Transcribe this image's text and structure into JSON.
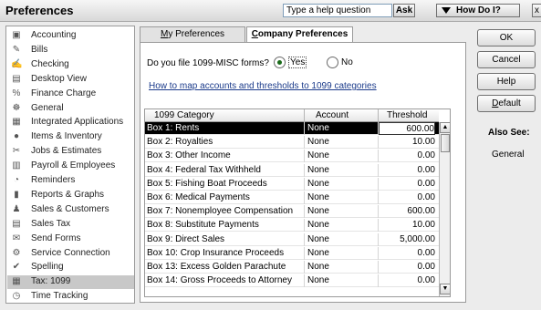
{
  "window": {
    "title": "Preferences",
    "help_placeholder": "Type a help question",
    "ask_label": "Ask",
    "how_do_i_label": "How Do I?",
    "close_label": "x"
  },
  "sidebar": {
    "items": [
      {
        "label": "Accounting",
        "icon": "accounting-icon",
        "glyph": "▣"
      },
      {
        "label": "Bills",
        "icon": "bills-icon",
        "glyph": "✎"
      },
      {
        "label": "Checking",
        "icon": "checking-icon",
        "glyph": "✍"
      },
      {
        "label": "Desktop View",
        "icon": "desktop-view-icon",
        "glyph": "▤"
      },
      {
        "label": "Finance Charge",
        "icon": "finance-charge-icon",
        "glyph": "%"
      },
      {
        "label": "General",
        "icon": "general-icon",
        "glyph": "☸"
      },
      {
        "label": "Integrated Applications",
        "icon": "integrated-apps-icon",
        "glyph": "▦"
      },
      {
        "label": "Items & Inventory",
        "icon": "items-inventory-icon",
        "glyph": "●"
      },
      {
        "label": "Jobs & Estimates",
        "icon": "jobs-estimates-icon",
        "glyph": "✂"
      },
      {
        "label": "Payroll & Employees",
        "icon": "payroll-icon",
        "glyph": "▥"
      },
      {
        "label": "Reminders",
        "icon": "reminders-icon",
        "glyph": "◔"
      },
      {
        "label": "Reports & Graphs",
        "icon": "reports-graphs-icon",
        "glyph": "▮"
      },
      {
        "label": "Sales & Customers",
        "icon": "sales-customers-icon",
        "glyph": "♟"
      },
      {
        "label": "Sales Tax",
        "icon": "sales-tax-icon",
        "glyph": "▤"
      },
      {
        "label": "Send Forms",
        "icon": "send-forms-icon",
        "glyph": "✉"
      },
      {
        "label": "Service Connection",
        "icon": "service-connection-icon",
        "glyph": "⚙"
      },
      {
        "label": "Spelling",
        "icon": "spelling-icon",
        "glyph": "✔"
      },
      {
        "label": "Tax: 1099",
        "icon": "tax-1099-icon",
        "glyph": "▦"
      },
      {
        "label": "Time Tracking",
        "icon": "time-tracking-icon",
        "glyph": "◷"
      }
    ],
    "selected_index": 17
  },
  "tabs": {
    "my_prefix": "",
    "my_hotkey": "M",
    "my_rest": "y Preferences",
    "company_hotkey": "C",
    "company_rest": "ompany Preferences"
  },
  "form": {
    "question": "Do you file 1099-MISC forms?",
    "yes_label": "Yes",
    "no_label": "No",
    "selected": "yes",
    "map_link": "How to map accounts and thresholds to 1099 categories"
  },
  "table": {
    "headers": [
      "1099 Category",
      "Account",
      "Threshold"
    ],
    "rows": [
      {
        "category": "Box 1: Rents",
        "account": "None",
        "threshold": "600.00"
      },
      {
        "category": "Box 2: Royalties",
        "account": "None",
        "threshold": "10.00"
      },
      {
        "category": "Box 3: Other Income",
        "account": "None",
        "threshold": "0.00"
      },
      {
        "category": "Box 4: Federal Tax Withheld",
        "account": "None",
        "threshold": "0.00"
      },
      {
        "category": "Box 5: Fishing Boat Proceeds",
        "account": "None",
        "threshold": "0.00"
      },
      {
        "category": "Box 6: Medical Payments",
        "account": "None",
        "threshold": "0.00"
      },
      {
        "category": "Box 7: Nonemployee Compensation",
        "account": "None",
        "threshold": "600.00"
      },
      {
        "category": "Box 8: Substitute Payments",
        "account": "None",
        "threshold": "10.00"
      },
      {
        "category": "Box 9: Direct Sales",
        "account": "None",
        "threshold": "5,000.00"
      },
      {
        "category": "Box 10: Crop Insurance Proceeds",
        "account": "None",
        "threshold": "0.00"
      },
      {
        "category": "Box 13: Excess Golden Parachute",
        "account": "None",
        "threshold": "0.00"
      },
      {
        "category": "Box 14: Gross Proceeds to Attorney",
        "account": "None",
        "threshold": "0.00"
      }
    ],
    "selected_index": 0
  },
  "buttons": {
    "ok": "OK",
    "cancel": "Cancel",
    "help": "Help",
    "default_hotkey": "D",
    "default_rest": "efault"
  },
  "also_see": {
    "title": "Also See:",
    "link": "General"
  }
}
